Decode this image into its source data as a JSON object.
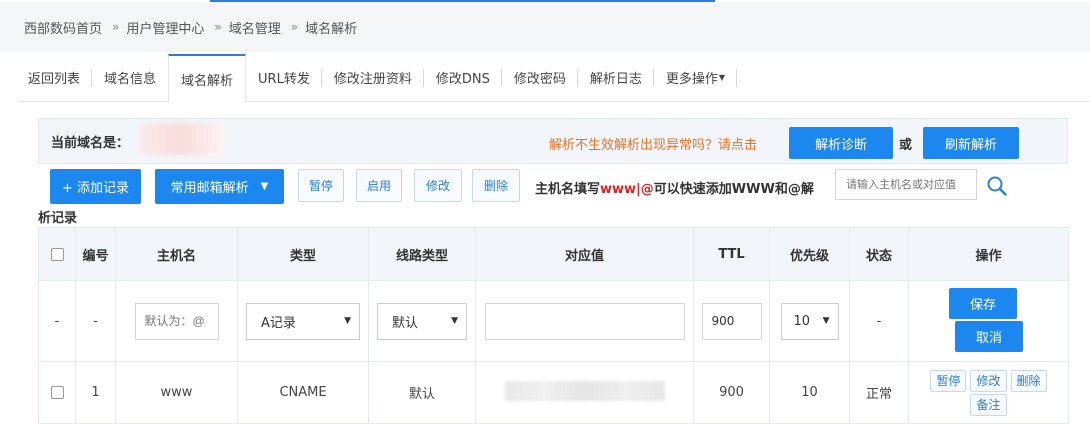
{
  "breadcrumb": {
    "items": [
      "西部数码首页",
      "用户管理中心",
      "域名管理",
      "域名解析"
    ],
    "separator": "»"
  },
  "tabs": [
    {
      "label": "返回列表"
    },
    {
      "label": "域名信息"
    },
    {
      "label": "域名解析",
      "active": true
    },
    {
      "label": "URL转发"
    },
    {
      "label": "修改注册资料"
    },
    {
      "label": "修改DNS"
    },
    {
      "label": "修改密码"
    },
    {
      "label": "解析日志"
    },
    {
      "label": "更多操作"
    }
  ],
  "info": {
    "current_domain_label": "当前域名是：",
    "warning": "解析不生效解析出现异常吗？请点击",
    "diagnose_button": "解析诊断",
    "or_text": "或",
    "refresh_button": "刷新解析"
  },
  "toolbar": {
    "add_record": "+ 添加记录",
    "mail_parse": "常用邮箱解析",
    "pause": "暂停",
    "enable": "启用",
    "modify": "修改",
    "delete": "删除",
    "hint_prefix": "主机名填写",
    "hint_red": "www|@",
    "hint_suffix": "可以快速添加WWW和@解",
    "hint_wrap": "析记录",
    "search_placeholder": "请输入主机名或对应值"
  },
  "table": {
    "headers": [
      "编号",
      "主机名",
      "类型",
      "线路类型",
      "对应值",
      "TTL",
      "优先级",
      "状态",
      "操作"
    ],
    "new_row": {
      "index": "-",
      "id": "-",
      "host_placeholder": "默认为：@",
      "type": "A记录",
      "line": "默认",
      "value": "",
      "ttl": "900",
      "priority": "10",
      "status": "-",
      "save": "保存",
      "cancel": "取消"
    },
    "rows": [
      {
        "id": "1",
        "host": "www",
        "type": "CNAME",
        "line": "默认",
        "ttl": "900",
        "priority": "10",
        "status": "正常",
        "actions": [
          "暂停",
          "修改",
          "删除",
          "备注"
        ]
      }
    ]
  },
  "colors": {
    "accent": "#1c88ef",
    "warning": "#f07020",
    "hint_red": "#e02020",
    "status_ok": "#1f9d3a"
  }
}
